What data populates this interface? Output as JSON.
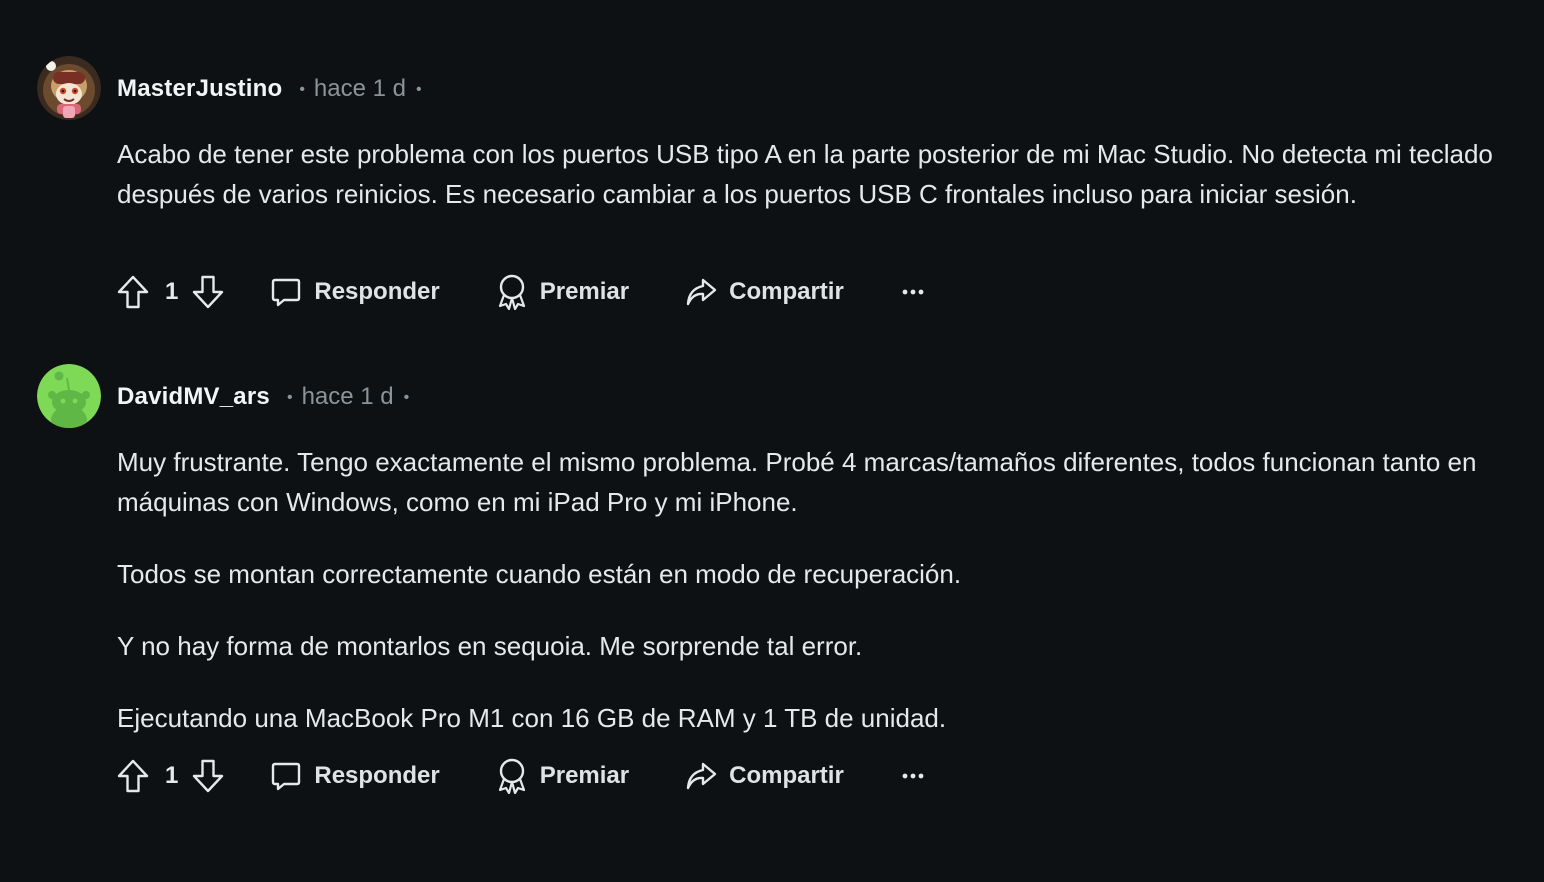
{
  "comments": [
    {
      "username": "MasterJustino",
      "dot": "•",
      "time": "hace 1 d",
      "avatar_icon": "cartoon-avatar-icon",
      "paragraphs": [
        "Acabo de tener este problema con los puertos USB tipo A en la parte posterior de mi Mac Studio. No detecta mi teclado después de varios reinicios. Es necesario cambiar a los puertos USB C frontales incluso para iniciar sesión."
      ],
      "votes": "1",
      "reply_label": "Responder",
      "award_label": "Premiar",
      "share_label": "Compartir"
    },
    {
      "username": "DavidMV_ars",
      "dot": "•",
      "time": "hace 1 d",
      "avatar_icon": "snoo-avatar-icon",
      "paragraphs": [
        "Muy frustrante. Tengo exactamente el mismo problema. Probé 4 marcas/tamaños diferentes, todos funcionan tanto en máquinas con Windows, como en mi iPad Pro y mi iPhone.",
        "Todos se montan correctamente cuando están en modo de recuperación.",
        "Y no hay forma de montarlos en sequoia. Me sorprende tal error.",
        "Ejecutando una MacBook Pro M1 con 16 GB de RAM y 1 TB de unidad."
      ],
      "votes": "1",
      "reply_label": "Responder",
      "award_label": "Premiar",
      "share_label": "Compartir"
    }
  ],
  "icons": {
    "upvote": "upvote-arrow-icon",
    "downvote": "downvote-arrow-icon",
    "reply": "speech-bubble-icon",
    "award": "award-ribbon-icon",
    "share": "share-arrow-icon",
    "more": "more-options-icon"
  },
  "colors": {
    "background": "#0e1113",
    "text": "#e6e8ea",
    "muted": "#8b9499",
    "snoo_green": "#7ed957"
  }
}
